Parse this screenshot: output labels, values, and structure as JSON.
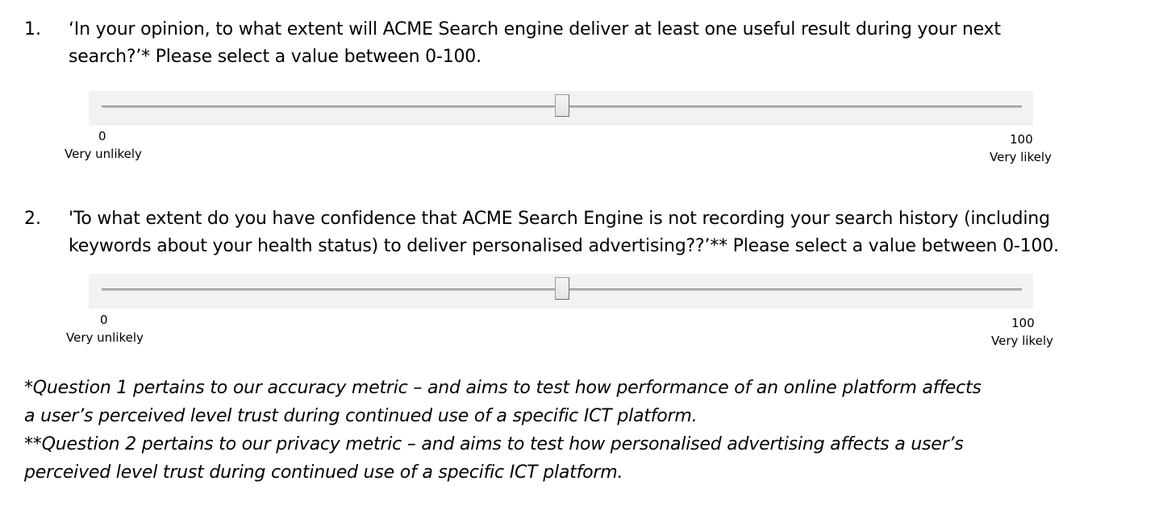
{
  "questions": [
    {
      "number": "1.",
      "text_lines": [
        "‘In your opinion, to what extent will ACME Search engine deliver at least one useful result during your next",
        "search?’* Please select a value between 0-100."
      ],
      "slider": {
        "value": 50,
        "min_label": "0",
        "max_label": "100",
        "min_anchor": "Very unlikely",
        "max_anchor": "Very likely"
      }
    },
    {
      "number": "2.",
      "text_lines": [
        "'To what extent do you have confidence that ACME Search Engine is not recording your search history (including",
        "keywords about your health status) to deliver personalised advertising??’** Please select a value between 0-100."
      ],
      "slider": {
        "value": 50,
        "min_label": "0",
        "max_label": "100",
        "min_anchor": "Very unlikely",
        "max_anchor": "Very likely"
      }
    }
  ],
  "footnotes": [
    "*Question 1 pertains to our accuracy metric – and aims to test how performance of an online platform affects",
    "a user’s perceived level trust during continued use of a specific ICT platform.",
    "**Question 2 pertains to our privacy metric – and aims to test how personalised advertising affects a user’s",
    "perceived level trust during continued use of a specific ICT platform."
  ]
}
